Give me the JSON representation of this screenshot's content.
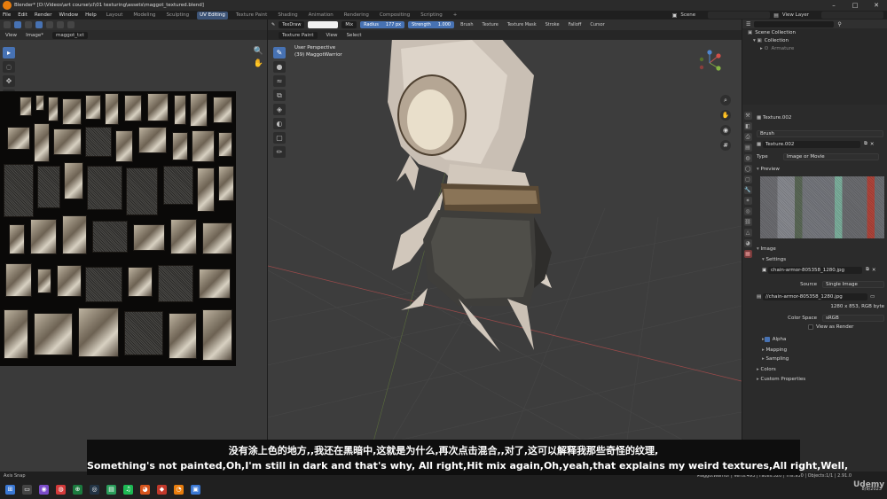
{
  "window": {
    "title": "Blender* [D:\\Videos\\art course\\cl\\01 texturing\\assets\\maggot_textured.blend]"
  },
  "menu": {
    "items": [
      "File",
      "Edit",
      "Render",
      "Window",
      "Help"
    ],
    "workspaces": [
      "Layout",
      "Modeling",
      "Sculpting",
      "UV Editing",
      "Texture Paint",
      "Shading",
      "Animation",
      "Rendering",
      "Compositing",
      "Scripting"
    ],
    "active_workspace": "UV Editing",
    "scene_label": "Scene",
    "view_layer_label": "View Layer"
  },
  "uv_editor": {
    "header": {
      "view": "View",
      "image_menu": "Image*",
      "image_name": "maggot_txt"
    }
  },
  "viewport": {
    "header": {
      "brush": "TexDraw",
      "blend": "Mix",
      "radius_label": "Radius",
      "radius_value": "177 px",
      "strength_label": "Strength",
      "strength_value": "1.000",
      "menus": [
        "Brush",
        "Texture",
        "Texture Mask",
        "Stroke",
        "Falloff",
        "Cursor"
      ]
    },
    "mode_header": {
      "mode": "Texture Paint",
      "view": "View",
      "select": "Select"
    },
    "info_line1": "User Perspective",
    "info_line2": "(39) MaggotWarrior"
  },
  "outliner": {
    "scene_collection": "Scene Collection",
    "collection": "Collection",
    "armature": "Armature"
  },
  "properties": {
    "texture_name": "Texture.002",
    "brush_label": "Brush",
    "texture_field": "Texture.002",
    "type_label": "Type",
    "type_value": "Image or Movie",
    "preview_label": "Preview",
    "image_label": "Image",
    "settings_label": "Settings",
    "image_file": "chain-armor-805358_1280.jpg",
    "source_label": "Source",
    "source_value": "Single Image",
    "path_value": "//chain-armor-805358_1280.jpg",
    "image_info": "1280 x 853, RGB byte",
    "color_space_label": "Color Space",
    "color_space_value": "sRGB",
    "view_as_render": "View as Render",
    "alpha": "Alpha",
    "mapping": "Mapping",
    "sampling": "Sampling",
    "colors": "Colors",
    "custom_properties": "Custom Properties"
  },
  "status_bar": {
    "left": "Axis Snap",
    "right": "MaggotWarrior | Verts:493 | Faces:520 | Tris:930 | Objects:1/1 | 2.91.0"
  },
  "subtitles": {
    "zh": "没有涂上色的地方,,我还在黑暗中,这就是为什么,再次点击混合,,对了,这可以解释我那些奇怪的纹理,",
    "en": "Something's not painted,Oh,I'm still in dark and that's why, All right,Hit mix again,Oh,yeah,that explains my weird textures,All right,Well,"
  },
  "taskbar": {
    "time": "",
    "date": "8/9/2023"
  },
  "watermark": "Udemy",
  "colors": {
    "accent_blue": "#4772b3",
    "workspace_active": "#3d5477",
    "blender_orange": "#e87d0d"
  }
}
